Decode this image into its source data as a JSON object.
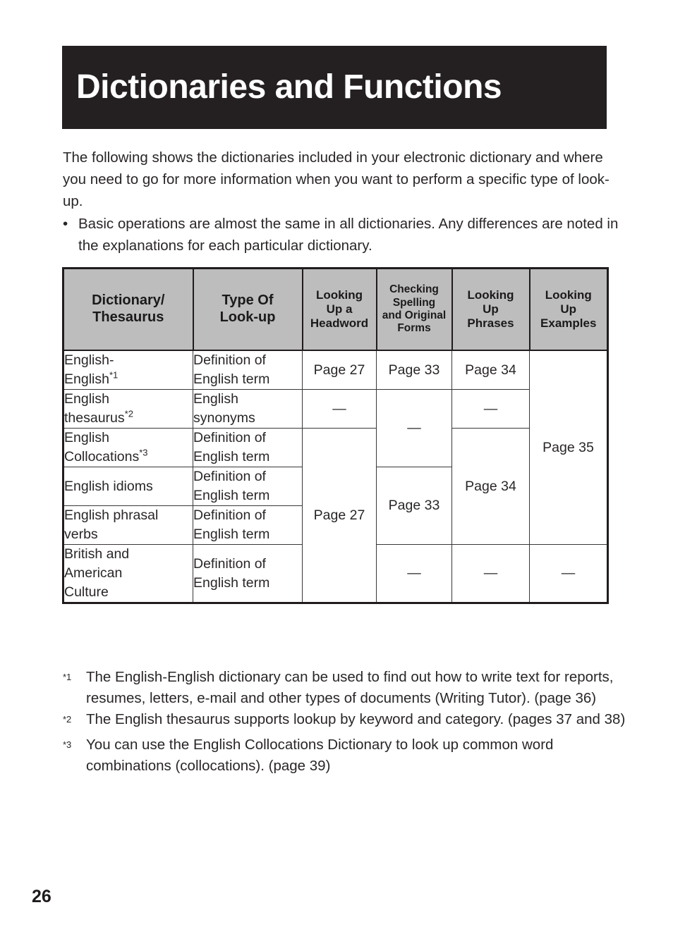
{
  "document": {
    "title": "Dictionaries and Functions",
    "page_number": "26"
  },
  "intro": {
    "paragraph": "The following shows the dictionaries included in your electronic dictionary and where you need to go for more information when you want to perform a specific type of look-up.",
    "bullet_marker": "•",
    "bullet_text": "Basic operations are almost the same in all dictionaries. Any differences are noted in the explanations for each particular dictionary."
  },
  "table": {
    "headers": [
      "Dictionary/ Thesaurus",
      "Type Of Look-up",
      "Looking Up a Headword",
      "Checking Spelling and Original Forms",
      "Looking Up Phrases",
      "Looking Up Examples"
    ],
    "header_lines": {
      "h1_l1": "Dictionary/",
      "h1_l2": "Thesaurus",
      "h2_l1": "Type Of",
      "h2_l2": "Look-up",
      "h3_l1": "Looking",
      "h3_l2": "Up a",
      "h3_l3": "Headword",
      "h4_l1": "Checking",
      "h4_l2": "Spelling",
      "h4_l3": "and Original",
      "h4_l4": "Forms",
      "h5_l1": "Looking",
      "h5_l2": "Up",
      "h5_l3": "Phrases",
      "h6_l1": "Looking",
      "h6_l2": "Up",
      "h6_l3": "Examples"
    },
    "rows": [
      {
        "dictionary_l1": "English-",
        "dictionary_l2": "English",
        "dictionary_fn": "*1",
        "type_l1": "Definition of",
        "type_l2": "English term",
        "headword": "Page 27",
        "spelling": "Page 33",
        "phrases": "Page 34",
        "examples": "Page 35"
      },
      {
        "dictionary_l1": "English",
        "dictionary_l2": "thesaurus",
        "dictionary_fn": "*2",
        "type_l1": "English",
        "type_l2": "synonyms",
        "headword": "—",
        "spelling": "—",
        "phrases": "—",
        "examples": ""
      },
      {
        "dictionary_l1": "English",
        "dictionary_l2": "Collocations",
        "dictionary_fn": "*3",
        "type_l1": "Definition of",
        "type_l2": "English term",
        "headword": "Page 27",
        "spelling": "",
        "phrases": "Page 34",
        "examples": ""
      },
      {
        "dictionary_l1": "English idioms",
        "dictionary_l2": "",
        "dictionary_fn": "",
        "type_l1": "Definition of",
        "type_l2": "English term",
        "headword": "",
        "spelling": "Page 33",
        "phrases": "",
        "examples": ""
      },
      {
        "dictionary_l1": "English phrasal",
        "dictionary_l2": "verbs",
        "dictionary_fn": "",
        "type_l1": "Definition of",
        "type_l2": "English term",
        "headword": "",
        "spelling": "",
        "phrases": "",
        "examples": ""
      },
      {
        "dictionary_l1": "British and",
        "dictionary_l2": "American",
        "dictionary_l3": "Culture",
        "dictionary_fn": "",
        "type_l1": "Definition of",
        "type_l2": "English term",
        "headword": "",
        "spelling": "—",
        "phrases": "—",
        "examples": "—"
      }
    ],
    "merged_values": {
      "headword_rows_3_6": "Page 27",
      "spelling_rows_2_3": "—",
      "spelling_rows_4_5": "Page 33",
      "phrases_rows_3_5": "Page 34",
      "examples_rows_1_5": "Page 35"
    }
  },
  "footnotes": [
    {
      "marker": "*1",
      "text": "The English-English dictionary can be used to find out how to write text for reports, resumes, letters, e-mail and other types of documents (Writing Tutor). (page 36)"
    },
    {
      "marker": "*2",
      "text": "The English thesaurus supports lookup by keyword and category. (pages 37 and 38)"
    },
    {
      "marker": "*3",
      "text": "You can use the English Collocations Dictionary to look up common word combinations (collocations). (page 39)"
    }
  ],
  "colors": {
    "banner_background": "#242022",
    "banner_text": "#ffffff",
    "table_header_background": "#bdbdbd",
    "table_border": "#201c1e",
    "body_text": "#2a2628"
  }
}
